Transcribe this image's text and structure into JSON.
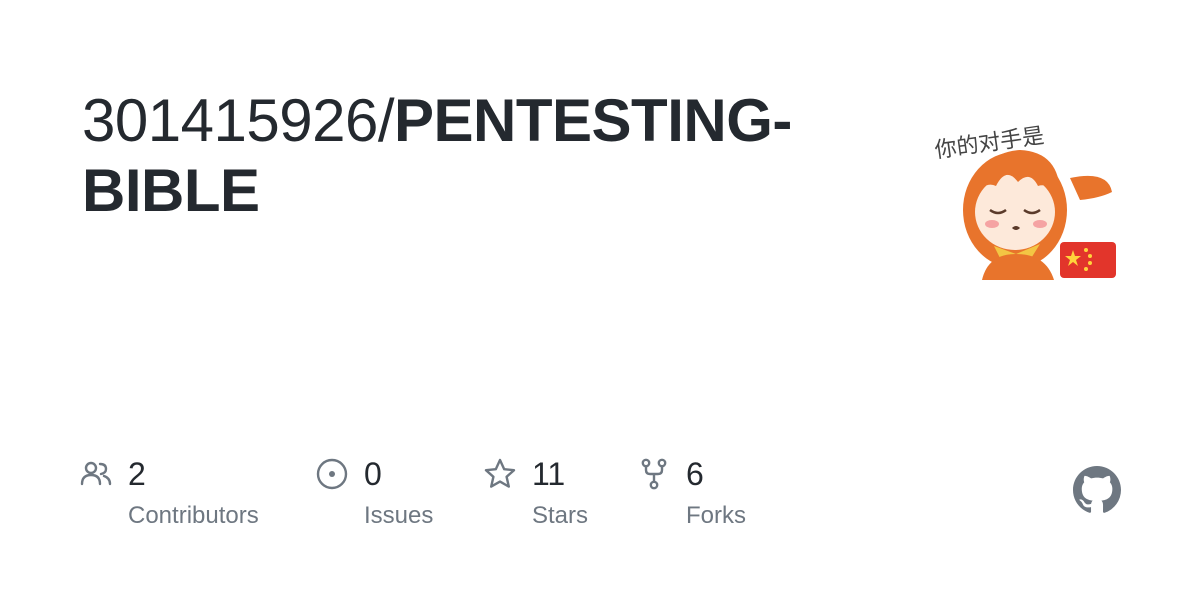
{
  "repo": {
    "owner": "301415926/",
    "name_part1": "PENTESTING-",
    "name_part2": "BIBLE"
  },
  "avatar": {
    "caption": "你的对手是",
    "icon": "anime-girl-with-china-flag-avatar"
  },
  "stats": [
    {
      "icon": "people-icon",
      "value": "2",
      "label": "Contributors"
    },
    {
      "icon": "issue-circle-icon",
      "value": "0",
      "label": "Issues"
    },
    {
      "icon": "star-icon",
      "value": "11",
      "label": "Stars"
    },
    {
      "icon": "repo-forked-icon",
      "value": "6",
      "label": "Forks"
    }
  ],
  "colors": {
    "text": "#24292f",
    "muted": "#6e7781",
    "icon": "#6e7781",
    "github_mark": "#6e7781"
  },
  "brand_icon": "github-mark-icon"
}
